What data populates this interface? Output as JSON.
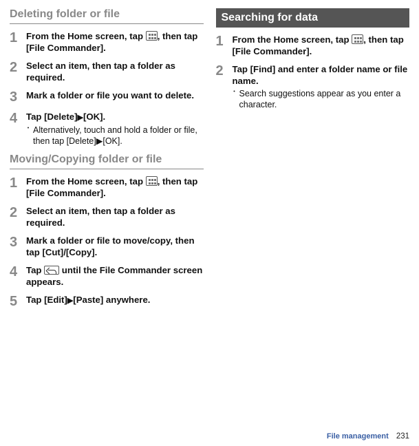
{
  "left": {
    "section1": {
      "title": "Deleting folder or file",
      "steps": [
        {
          "num": "1",
          "text_before": "From the Home screen, tap ",
          "text_after": ", then tap [File Commander]."
        },
        {
          "num": "2",
          "text": "Select an item, then tap a folder as required."
        },
        {
          "num": "3",
          "text": "Mark a folder or file you want to delete."
        },
        {
          "num": "4",
          "text_before": "Tap [Delete]",
          "arrow": "▶",
          "text_after": "[OK].",
          "note": "Alternatively, touch and hold a folder or file, then tap [Delete]▶[OK]."
        }
      ]
    },
    "section2": {
      "title": "Moving/Copying folder or file",
      "steps": [
        {
          "num": "1",
          "text_before": "From the Home screen, tap ",
          "text_after": ", then tap [File Commander]."
        },
        {
          "num": "2",
          "text": "Select an item, then tap a folder as required."
        },
        {
          "num": "3",
          "text": "Mark a folder or file to move/copy, then tap [Cut]/[Copy]."
        },
        {
          "num": "4",
          "text_before": "Tap ",
          "text_after": " until the File Commander screen appears."
        },
        {
          "num": "5",
          "text_before": "Tap [Edit]",
          "arrow": "▶",
          "text_after": "[Paste] anywhere."
        }
      ]
    }
  },
  "right": {
    "section1": {
      "title": "Searching for data",
      "steps": [
        {
          "num": "1",
          "text_before": "From the Home screen, tap ",
          "text_after": ", then tap [File Commander]."
        },
        {
          "num": "2",
          "text": "Tap [Find] and enter a folder name or file name.",
          "note": "Search suggestions appear as you enter a character."
        }
      ]
    }
  },
  "footer": {
    "label": "File management",
    "page": "231"
  }
}
